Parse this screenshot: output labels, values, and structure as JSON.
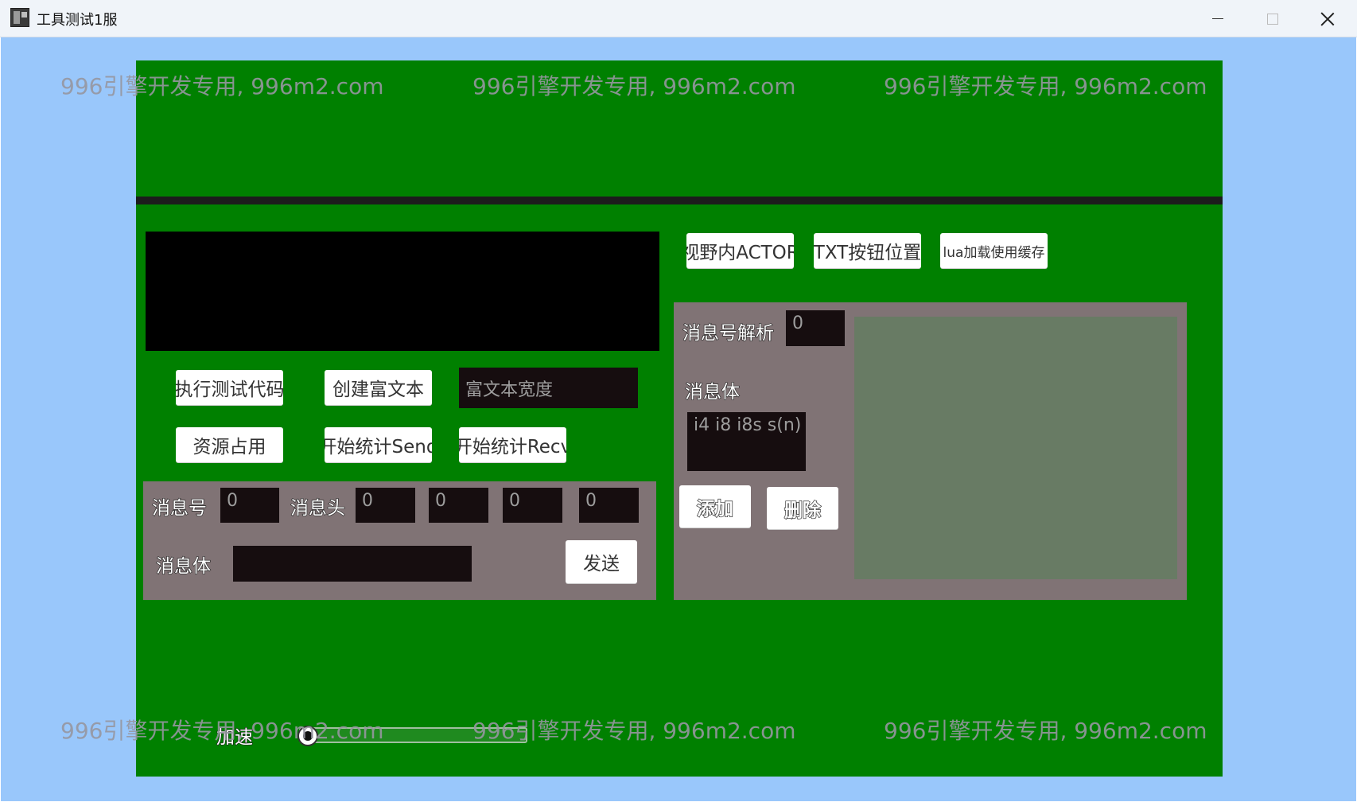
{
  "window": {
    "title": "工具测试1服",
    "icon": "app-icon",
    "controls": [
      "minimize-icon",
      "maximize-icon",
      "close-icon"
    ]
  },
  "watermark": "996引擎开发专用, 996m2.com",
  "toolbar": {
    "actor_label": "视野内ACTOR",
    "txt_label": "TXT按钮位置",
    "lua_label": "lua加载使用缓存"
  },
  "code_panel": {
    "run_label": "执行测试代码",
    "create_rich_label": "创建富文本",
    "rich_width_placeholder": "富文本宽度",
    "resource_label": "资源占用",
    "stat_send_label": "开始统计Send",
    "stat_recv_label": "开始统计Recv"
  },
  "send_panel": {
    "msg_id_label": "消息号",
    "msg_id_value": "0",
    "msg_head_label": "消息头",
    "msg_head_values": [
      "0",
      "0",
      "0",
      "0"
    ],
    "msg_body_label": "消息体",
    "msg_body_value": "",
    "send_label": "发送"
  },
  "parse_panel": {
    "msg_parse_label": "消息号解析",
    "msg_parse_value": "0",
    "msg_body_label": "消息体",
    "msg_body_value": "i4 i8 i8s s(n)",
    "add_label": "添加",
    "delete_label": "删除"
  },
  "speed": {
    "label": "加速",
    "value": 0
  },
  "colors": {
    "client_bg": "#99c7fb",
    "game_bg": "#008000",
    "panel_bg": "#807375",
    "output_bg": "#687b64",
    "field_bg": "#160d0f"
  }
}
